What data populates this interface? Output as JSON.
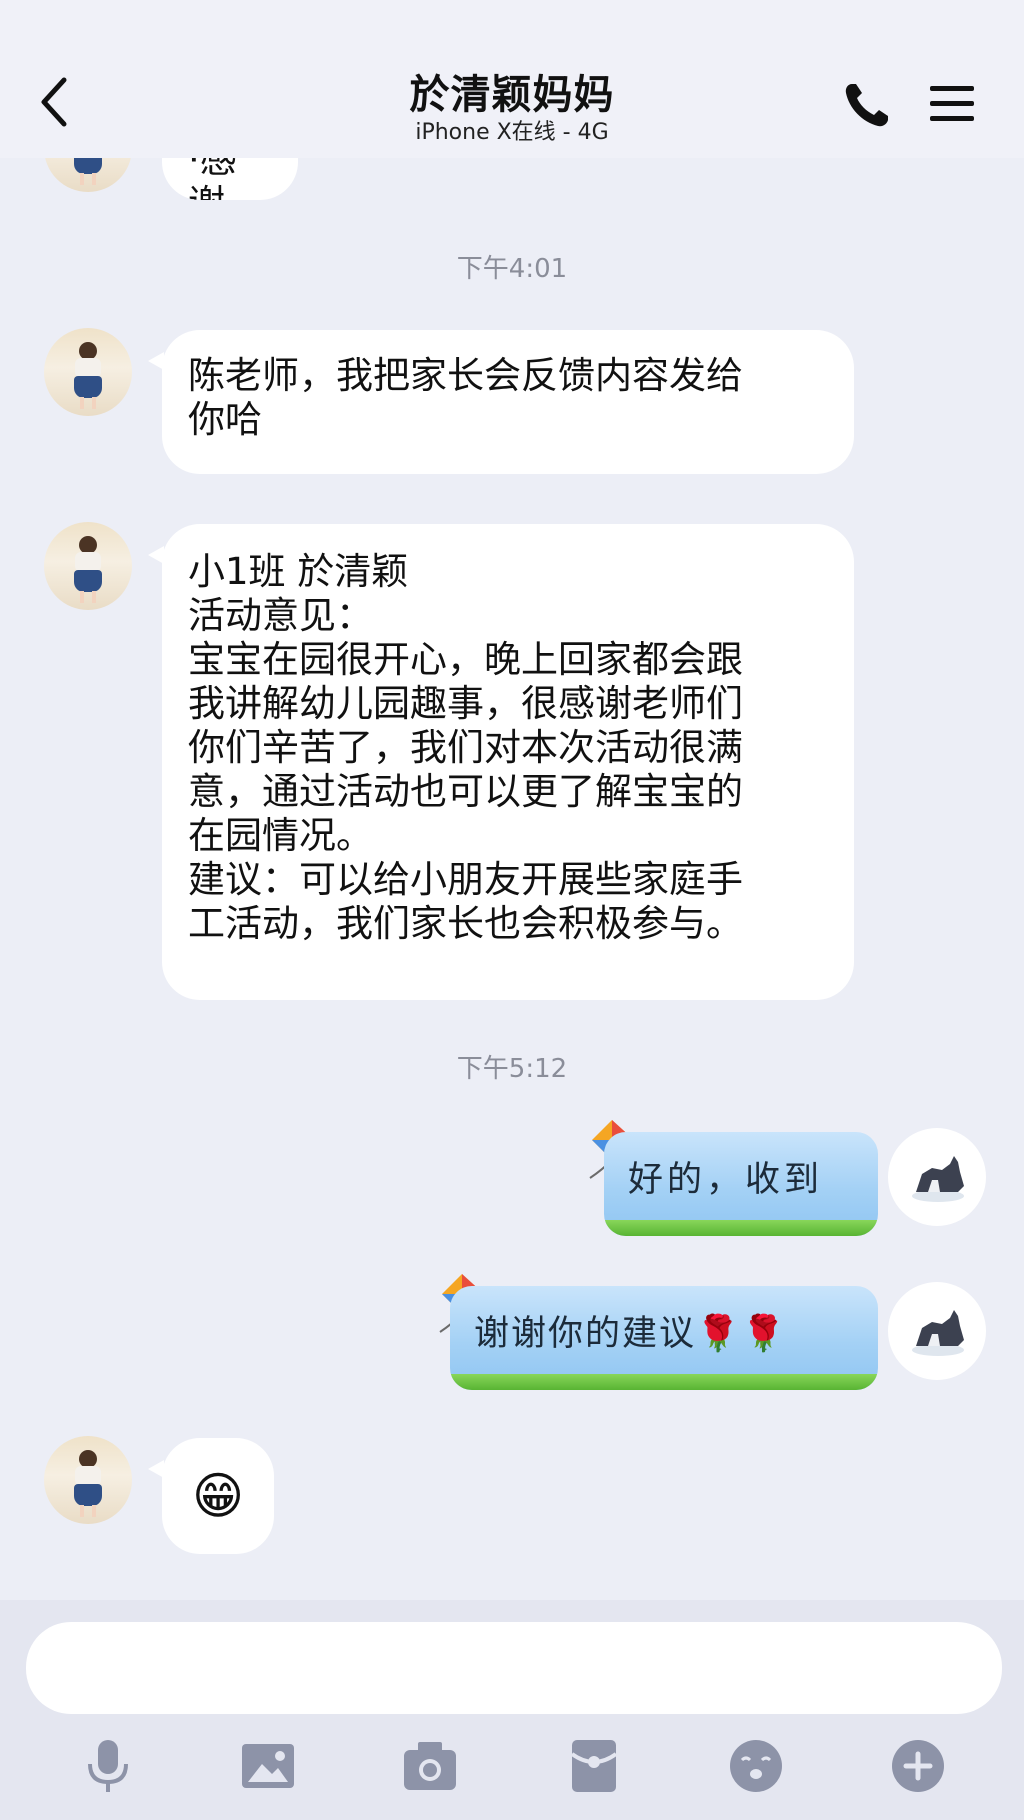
{
  "header": {
    "title": "於清颖妈妈",
    "subtitle": "iPhone X在线 - 4G",
    "icons": [
      "back-icon",
      "phone-icon",
      "menu-icon"
    ]
  },
  "messages": {
    "partial_prev_text": "·感谢",
    "time_1": "下午4:01",
    "msg_1": "陈老师，我把家长会反馈内容发给\n你哈",
    "msg_2": "小1班 於清颖\n活动意见：\n宝宝在园很开心，晚上回家都会跟\n我讲解幼儿园趣事，很感谢老师们\n你们辛苦了，我们对本次活动很满\n意，通过活动也可以更了解宝宝的\n在园情况。\n建议：可以给小朋友开展些家庭手\n工活动，我们家长也会积极参与。",
    "time_2": "下午5:12",
    "reply_1": "好的，收到",
    "reply_2": "谢谢你的建议🌹🌹",
    "emoji_reply": "😁"
  },
  "input": {
    "placeholder": ""
  },
  "toolbar": {
    "icons": [
      "microphone-icon",
      "image-icon",
      "camera-icon",
      "red-packet-icon",
      "emoji-icon",
      "plus-icon"
    ]
  },
  "colors": {
    "background": "#eceef6",
    "bubble_white": "#ffffff",
    "icon_gray": "#8d93a8",
    "sky_blue": "#a4d1f5"
  }
}
